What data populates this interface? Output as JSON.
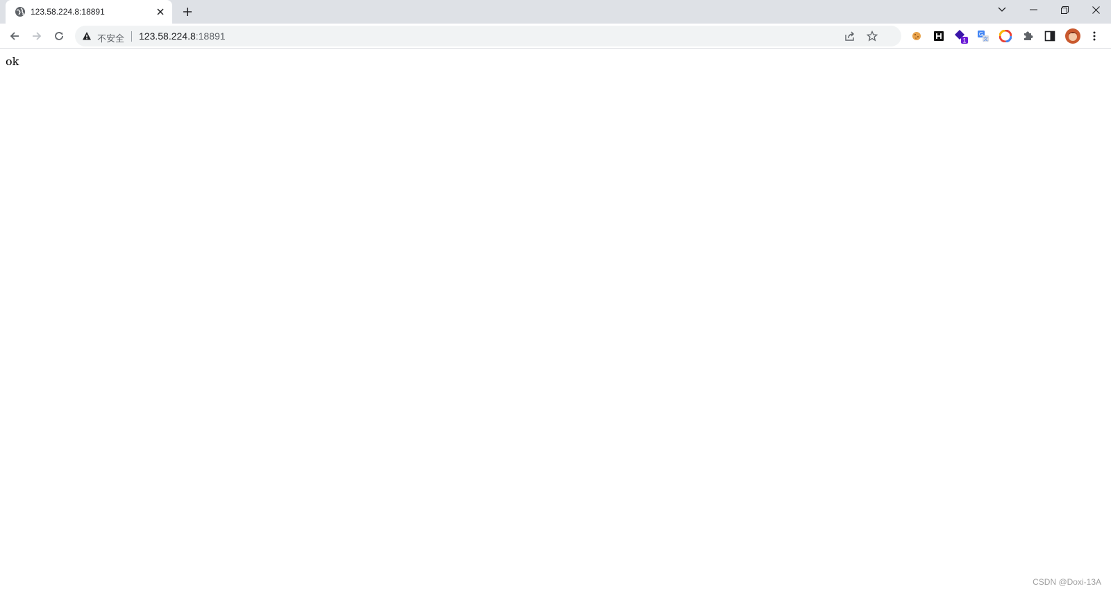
{
  "tab": {
    "title": "123.58.224.8:18891",
    "favicon": "globe-icon"
  },
  "window_controls": [
    "tab-search-icon",
    "minimize-icon",
    "restore-icon",
    "close-icon"
  ],
  "toolbar": {
    "security_label": "不安全",
    "url_host": "123.58.224.8",
    "url_port": ":18891"
  },
  "extensions": [
    "cookie-extension-icon",
    "h-extension-icon",
    "purple-diamond-extension-icon",
    "translate-extension-icon",
    "color-picker-extension-icon",
    "puzzle-icon",
    "side-panel-icon",
    "profile-avatar",
    "menu-kebab-icon"
  ],
  "extension_badge": "1",
  "page": {
    "body_text": "ok"
  },
  "watermark": "CSDN @Doxi-13A",
  "colors": {
    "tabstrip": "#dee1e6",
    "omnibox": "#f1f3f4",
    "text": "#202124",
    "secondary": "#5f6368",
    "badge": "#6a1bd6"
  }
}
